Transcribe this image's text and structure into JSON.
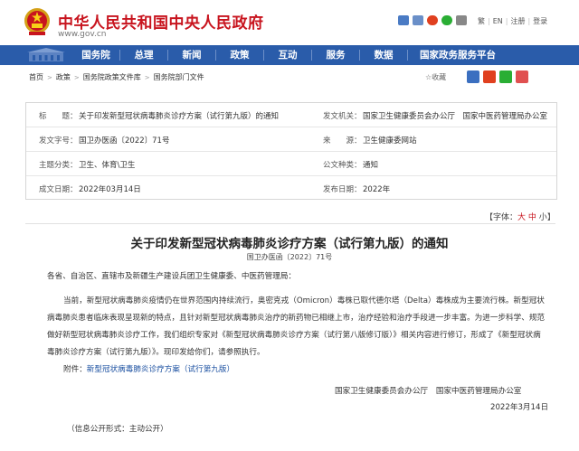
{
  "header": {
    "title": "中华人民共和国中央人民政府",
    "url": "www.gov.cn",
    "links": [
      "繁",
      "EN",
      "注册",
      "登录"
    ]
  },
  "nav": {
    "items": [
      "国务院",
      "总理",
      "新闻",
      "政策",
      "互动",
      "服务",
      "数据",
      "国家政务服务平台"
    ]
  },
  "breadcrumb": [
    "首页",
    "政策",
    "国务院政策文件库",
    "国务院部门文件"
  ],
  "share": {
    "favorite": "收藏"
  },
  "meta": {
    "title_label": "标　　题：",
    "title_value": "关于印发新型冠状病毒肺炎诊疗方案（试行第九版）的通知",
    "issuer_label": "发文机关：",
    "issuer_value": "国家卫生健康委员会办公厅　国家中医药管理局办公室",
    "doc_no_label": "发文字号：",
    "doc_no_value": "国卫办医函〔2022〕71号",
    "source_label": "来　　源：",
    "source_value": "卫生健康委网站",
    "topic_label": "主题分类：",
    "topic_value": "卫生、体育\\卫生",
    "type_label": "公文种类：",
    "type_value": "通知",
    "date_label": "成文日期：",
    "date_value": "2022年03月14日",
    "pub_label": "发布日期：",
    "pub_value": "2022年"
  },
  "fontsize": {
    "label": "【字体：",
    "big": "大",
    "mid": "中",
    "small": "小",
    "close": "】"
  },
  "doc": {
    "title": "关于印发新型冠状病毒肺炎诊疗方案（试行第九版）的通知",
    "number": "国卫办医函〔2022〕71号",
    "salutation": "各省、自治区、直辖市及新疆生产建设兵团卫生健康委、中医药管理局：",
    "body": "当前，新型冠状病毒肺炎疫情仍在世界范围内持续流行，奥密克戎（Omicron）毒株已取代德尔塔（Delta）毒株成为主要流行株。新型冠状病毒肺炎患者临床表现呈现新的特点，且针对新型冠状病毒肺炎治疗的新药物已相继上市，治疗经验和治疗手段进一步丰富。为进一步科学、规范做好新型冠状病毒肺炎诊疗工作，我们组织专家对《新型冠状病毒肺炎诊疗方案（试行第八版修订版）》相关内容进行修订，形成了《新型冠状病毒肺炎诊疗方案（试行第九版）》。现印发给你们，请参照执行。",
    "attachment_label": "附件：",
    "attachment_link": "新型冠状病毒肺炎诊疗方案（试行第九版）",
    "signature": "国家卫生健康委员会办公厅 国家中医药管理局办公室",
    "sign_date": "2022年3月14日",
    "publicity": "（信息公开形式：主动公开）"
  },
  "colors": {
    "brand_red": "#c8141e",
    "nav_blue": "#2a5caa",
    "link_blue": "#1a4fa0"
  }
}
